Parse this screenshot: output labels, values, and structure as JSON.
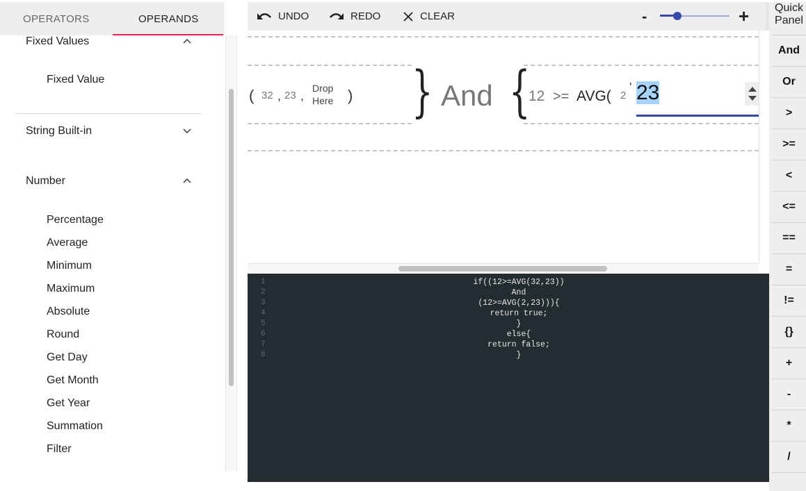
{
  "left_panel": {
    "tabs": [
      {
        "label": "OPERATORS",
        "active": false
      },
      {
        "label": "OPERANDS",
        "active": true
      }
    ],
    "groups": [
      {
        "label": "Fixed Values",
        "expanded": true,
        "icon": "chevron-up-icon",
        "items": [
          "Fixed Value"
        ]
      },
      {
        "label": "String Built-in",
        "expanded": false,
        "icon": "chevron-down-icon",
        "items": []
      },
      {
        "label": "Number",
        "expanded": true,
        "icon": "chevron-up-icon",
        "items": [
          "Percentage",
          "Average",
          "Minimum",
          "Maximum",
          "Absolute",
          "Round",
          "Get Day",
          "Get Month",
          "Get Year",
          "Summation",
          "Filter"
        ]
      }
    ]
  },
  "toolbar": {
    "undo_label": "UNDO",
    "redo_label": "REDO",
    "clear_label": "CLEAR",
    "zoom_minus": "-",
    "zoom_plus": "+",
    "zoom_level_fraction": 0.25
  },
  "canvas": {
    "left_expr": {
      "open_paren": "(",
      "arg1": "32",
      "sep1": ",",
      "arg2": "23",
      "sep2": ",",
      "drop_line1": "Drop",
      "drop_line2": "Here",
      "close_paren": ")",
      "close_brace": "}"
    },
    "connector": "And",
    "right_expr": {
      "open_brace": "{",
      "lhs": "12",
      "operator": ">=",
      "func": "AVG(",
      "arg1": "2",
      "sep": "'",
      "editing_value": "23"
    }
  },
  "code_editor": {
    "lines": [
      {
        "n": "1",
        "text": "if((12>=AVG(32,23))"
      },
      {
        "n": "2",
        "text": "And"
      },
      {
        "n": "3",
        "text": "(12>=AVG(2,23))){"
      },
      {
        "n": "4",
        "text": "return true;"
      },
      {
        "n": "5",
        "text": "}"
      },
      {
        "n": "6",
        "text": "else{"
      },
      {
        "n": "7",
        "text": "return false;"
      },
      {
        "n": "8",
        "text": "}"
      }
    ]
  },
  "quick_panel": {
    "title_line1": "Quick",
    "title_line2": "Panel",
    "buttons": [
      "And",
      "Or",
      ">",
      ">=",
      "<",
      "<=",
      "==",
      "=",
      "!=",
      "{}",
      "+",
      "-",
      "*",
      "/"
    ]
  },
  "colors": {
    "tab_indicator": "#e8204f",
    "slider_accent": "#3949ab",
    "code_bg": "#232c31",
    "selection": "#a8d3fb"
  }
}
